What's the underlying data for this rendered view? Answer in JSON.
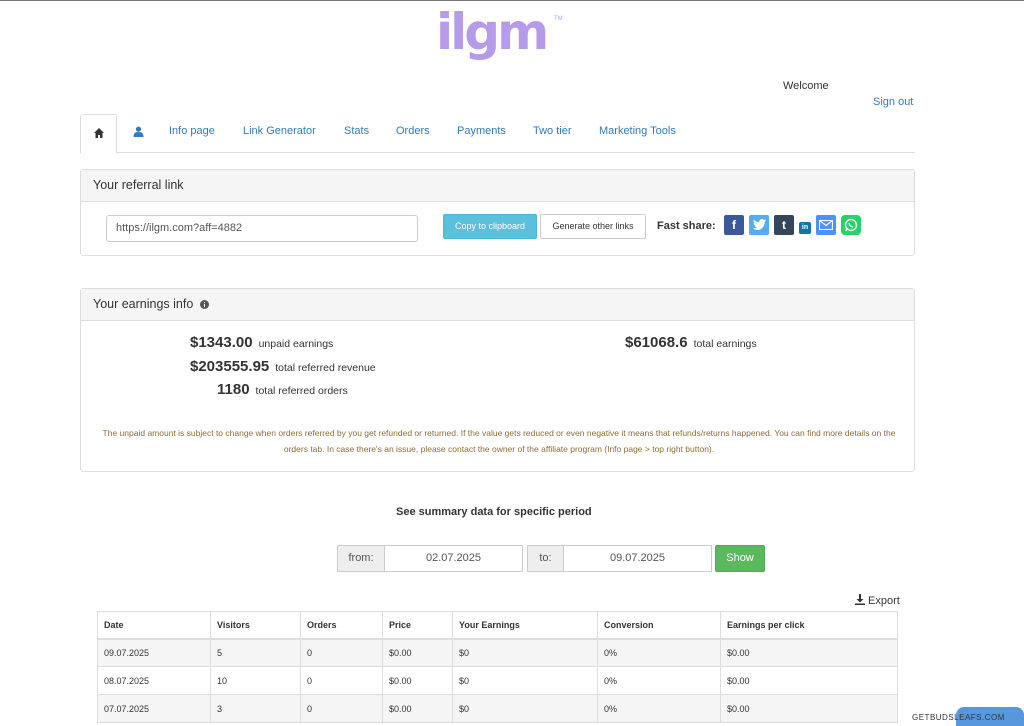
{
  "brand": {
    "logo_text": "ilgm",
    "logo_tm": "TM"
  },
  "header": {
    "welcome": "Welcome",
    "sign_out": "Sign out"
  },
  "nav": {
    "home_icon": "home-icon",
    "user_icon": "user-icon",
    "items": [
      "Info page",
      "Link Generator",
      "Stats",
      "Orders",
      "Payments",
      "Two tier",
      "Marketing Tools"
    ]
  },
  "referral": {
    "title": "Your referral link",
    "link": "https://ilgm.com?aff=4882",
    "copy_label": "Copy to clipboard",
    "generate_label": "Generate other links",
    "fast_share_label": "Fast share:",
    "share_icons": [
      "facebook-icon",
      "twitter-icon",
      "tumblr-icon",
      "linkedin-icon",
      "email-icon",
      "whatsapp-icon"
    ]
  },
  "earnings": {
    "title": "Your earnings info",
    "info_icon": "info-icon",
    "unpaid_value": "$1343.00",
    "unpaid_label": "unpaid earnings",
    "revenue_value": "$203555.95",
    "revenue_label": "total referred revenue",
    "orders_value": "1180",
    "orders_label": "total referred orders",
    "total_value": "$61068.6",
    "total_label": "total earnings",
    "note": "The unpaid amount is subject to change when orders referred by you get refunded or returned. If the value gets reduced or even negative it means that refunds/returns happened. You can find more details on the orders tab. In case there's an issue, please contact the owner of the affiliate program (Info page > top right button)."
  },
  "period": {
    "title": "See summary data for specific period",
    "from_label": "from:",
    "from_value": "02.07.2025",
    "to_label": "to:",
    "to_value": "09.07.2025",
    "show_label": "Show"
  },
  "export": {
    "label": "Export",
    "icon": "download-icon"
  },
  "table": {
    "headers": [
      "Date",
      "Visitors",
      "Orders",
      "Price",
      "Your Earnings",
      "Conversion",
      "Earnings per click"
    ],
    "rows": [
      [
        "09.07.2025",
        "5",
        "0",
        "$0.00",
        "$0",
        "0%",
        "$0.00"
      ],
      [
        "08.07.2025",
        "10",
        "0",
        "$0.00",
        "$0",
        "0%",
        "$0.00"
      ],
      [
        "07.07.2025",
        "3",
        "0",
        "$0.00",
        "$0",
        "0%",
        "$0.00"
      ]
    ]
  },
  "watermark": "GETBUDSLEAFS.COM",
  "colors": {
    "accent": "#337ab7",
    "info": "#5bc0de",
    "success": "#5cb85c",
    "logo": "#b59be8",
    "note": "#8a6d3b"
  }
}
